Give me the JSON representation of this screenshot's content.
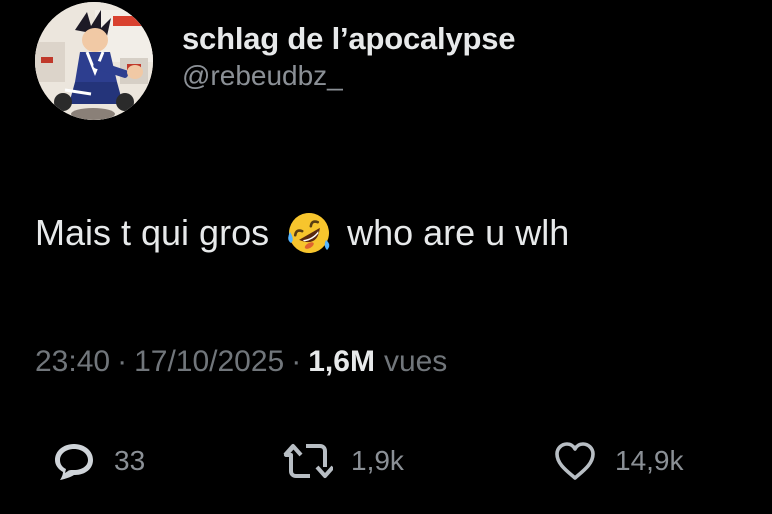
{
  "author": {
    "display_name": "schlag de l’apocalypse",
    "handle": "@rebeudbz_",
    "avatar_icon": "profile-avatar-anime-character"
  },
  "tweet": {
    "text_before_emoji": "Mais t qui gros",
    "emoji_icon": "rolling-on-floor-laughing-emoji",
    "text_after_emoji": "who are u wlh"
  },
  "meta": {
    "time": "23:40",
    "separator": "·",
    "date": "17/10/2025",
    "views_count": "1,6M",
    "views_label": "vues"
  },
  "actions": {
    "reply": {
      "icon": "reply-bubble-icon",
      "count": "33"
    },
    "retweet": {
      "icon": "retweet-icon",
      "count": "1,9k"
    },
    "like": {
      "icon": "heart-icon",
      "count": "14,9k"
    }
  },
  "colors": {
    "background": "#000000",
    "primary_text": "#e7e9ea",
    "secondary_text": "#71767b"
  }
}
